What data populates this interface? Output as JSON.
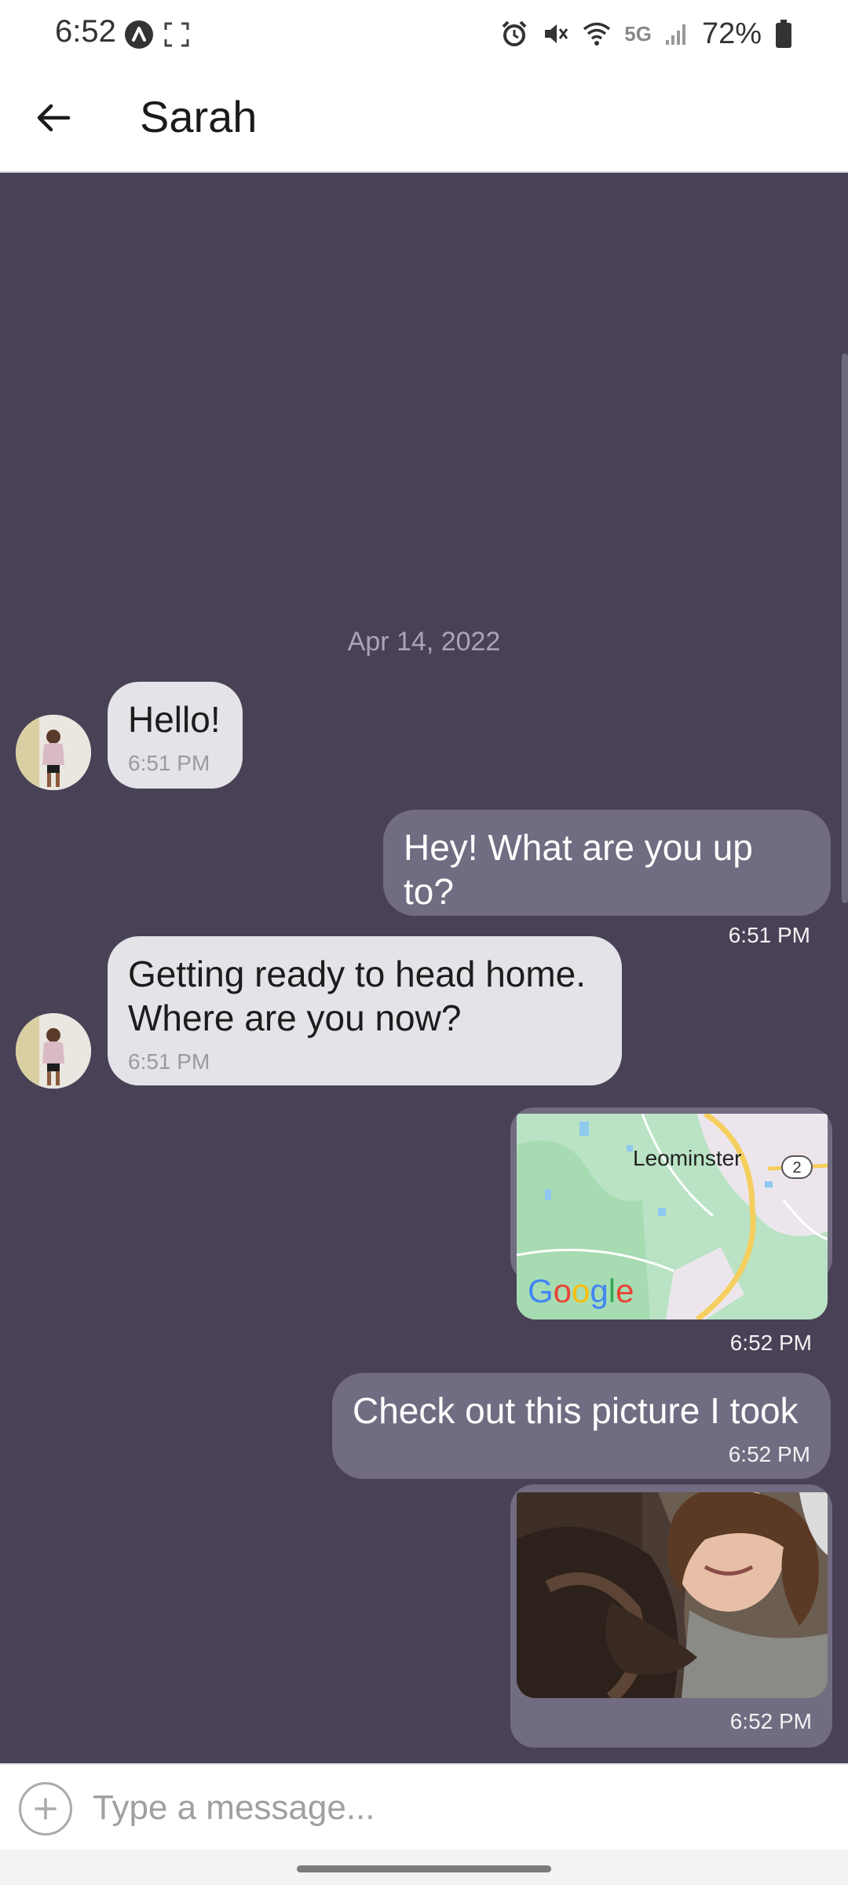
{
  "status_bar": {
    "time": "6:52",
    "network": "5G",
    "battery": "72%",
    "icons": [
      "app-notification-icon",
      "screenshot-icon",
      "alarm-icon",
      "mute-icon",
      "wifi-icon",
      "signal-icon",
      "battery-icon"
    ]
  },
  "header": {
    "title": "Sarah",
    "back_icon": "back-arrow-icon"
  },
  "chat": {
    "date_separator": "Apr 14, 2022",
    "messages": [
      {
        "direction": "incoming",
        "text": "Hello!",
        "time": "6:51 PM"
      },
      {
        "direction": "outgoing",
        "text": "Hey! What are you up to?",
        "time": "6:51 PM"
      },
      {
        "direction": "incoming",
        "text": "Getting ready to head home.\nWhere are you now?",
        "time": "6:51 PM"
      },
      {
        "direction": "outgoing",
        "type": "map",
        "map_label": "Leominster",
        "route_badge": "2",
        "brand": "Google",
        "time": "6:52 PM"
      },
      {
        "direction": "outgoing",
        "text": "Check out this picture I took",
        "time": "6:52 PM"
      },
      {
        "direction": "outgoing",
        "type": "photo",
        "time": "6:52 PM"
      }
    ]
  },
  "composer": {
    "placeholder": "Type a message...",
    "value": "",
    "add_icon": "plus-circle-icon"
  },
  "colors": {
    "chat_background": "#494156",
    "incoming_bubble": "#e3e3e8",
    "outgoing_bubble": "#716c81"
  }
}
